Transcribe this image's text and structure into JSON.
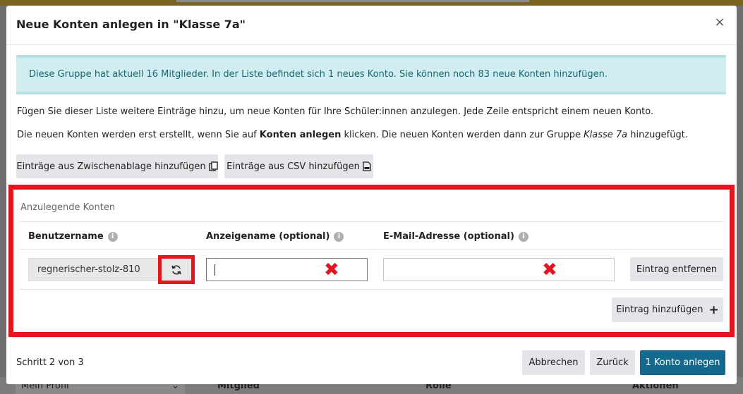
{
  "backdrop": {
    "profile_select": "Mein Profil",
    "col_member": "Mitglied",
    "col_role": "Rolle",
    "col_actions": "Aktionen"
  },
  "modal": {
    "title": "Neue Konten anlegen in \"Klasse 7a\"",
    "close_symbol": "×",
    "info": "Diese Gruppe hat aktuell 16 Mitglieder. In der Liste befindet sich 1 neues Konto. Sie können noch 83 neue Konten hinzufügen.",
    "paragraph1": "Fügen Sie dieser Liste weitere Einträge hinzu, um neue Konten für Ihre Schüler:innen anzulegen. Jede Zeile entspricht einem neuen Konto.",
    "paragraph2_a": "Die neuen Konten werden erst erstellt, wenn Sie auf ",
    "paragraph2_bold": "Konten anlegen",
    "paragraph2_b": " klicken. Die neuen Konten werden dann zur Gruppe ",
    "paragraph2_italic": "Klasse 7a",
    "paragraph2_c": " hinzugefügt.",
    "btn_clipboard": "Einträge aus Zwischenablage hinzufügen",
    "btn_csv": "Einträge aus CSV hinzufügen"
  },
  "accounts": {
    "caption": "Anzulegende Konten",
    "columns": {
      "username": "Benutzername",
      "display_name": "Anzeigename (optional)",
      "email": "E-Mail-Adresse (optional)"
    },
    "rows": [
      {
        "username": "regnerischer-stolz-810",
        "display_name": "",
        "email": ""
      }
    ],
    "btn_remove": "Eintrag entfernen",
    "btn_add": "Eintrag hinzufügen"
  },
  "footer": {
    "step": "Schritt 2 von 3",
    "btn_cancel": "Abbrechen",
    "btn_back": "Zurück",
    "btn_create": "1 Konto anlegen"
  },
  "colors": {
    "primary": "#146a8e",
    "highlight": "#e3161d",
    "info_bg": "#d0eef1",
    "info_text": "#1a6670"
  }
}
